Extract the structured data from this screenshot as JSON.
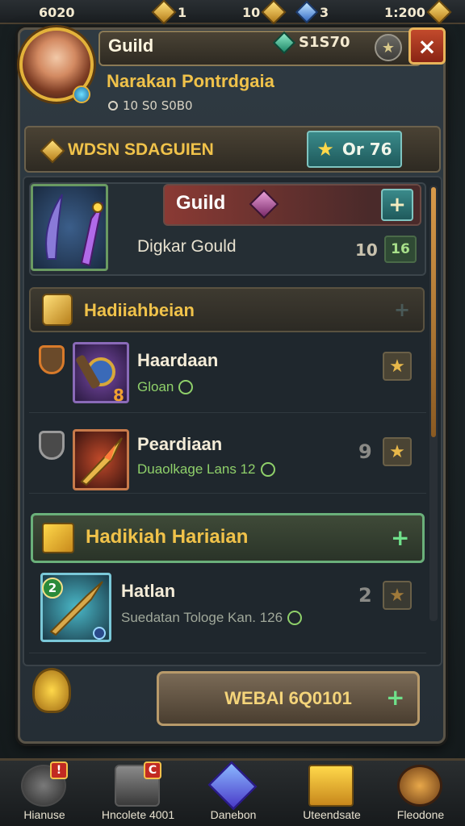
{
  "topbar": {
    "resource_1": "6020",
    "resource_2": "1",
    "resource_3": "10",
    "resource_4": "3",
    "resource_5": "1:200"
  },
  "header": {
    "title": "Guild",
    "currency": "S1S70",
    "close_glyph": "×",
    "star_glyph": "★",
    "subtitle": "Narakan Pontrdgaia",
    "subline": "10 S0 S0B0"
  },
  "banner": {
    "label": "WDSN SDAGUIEN",
    "button_label": "Or 76",
    "button_icon": "star-icon"
  },
  "guild_card": {
    "bar_title": "Guild",
    "name": "Digkar Gould",
    "count": "10",
    "badge": "16",
    "plus": "+"
  },
  "reward_section": {
    "title": "Hadiiahbeian",
    "plus": "+"
  },
  "rewards": [
    {
      "name": "Haardaan",
      "sub": "Gloan",
      "corner": "8",
      "count": "",
      "shield_color": "#d87a2a",
      "icon": "gauntlet-icon"
    },
    {
      "name": "Peardiaan",
      "sub": "Duaolkage Lans 12",
      "corner": "",
      "count": "9",
      "shield_color": "#9a9a9a",
      "icon": "spear-icon"
    }
  ],
  "daily_section": {
    "title": "Hadikiah Hariaian",
    "plus": "+"
  },
  "daily_rewards": [
    {
      "name": "Hatlan",
      "sub": "Suedatan Tologe Kan. 126",
      "count": "2",
      "level": "2",
      "icon": "dagger-icon"
    }
  ],
  "claim": {
    "label": "WEBAI 6Q0101",
    "plus": "+"
  },
  "nav": [
    {
      "label": "Hianuse",
      "alert": "!"
    },
    {
      "label": "Hncolete 4001",
      "alert": "C"
    },
    {
      "label": "Danebon",
      "alert": ""
    },
    {
      "label": "Uteendsate",
      "alert": ""
    },
    {
      "label": "Fleodone",
      "alert": ""
    }
  ],
  "colors": {
    "accent_gold": "#f0c24a",
    "teal_button": "#1f5a5c",
    "close_red": "#8a2414",
    "green_text": "#8fd06a"
  }
}
